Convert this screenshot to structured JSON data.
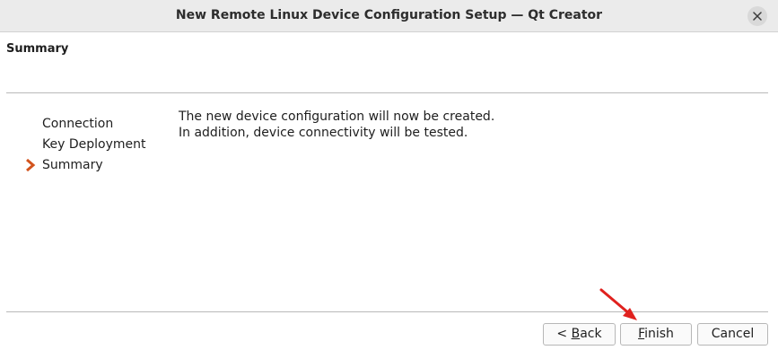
{
  "window": {
    "title": "New Remote Linux Device Configuration Setup — Qt Creator"
  },
  "page": {
    "title": "Summary"
  },
  "steps": [
    {
      "label": "Connection",
      "current": false
    },
    {
      "label": "Key Deployment",
      "current": false
    },
    {
      "label": "Summary",
      "current": true
    }
  ],
  "description": {
    "line1": "The new device configuration will now be created.",
    "line2": "In addition, device connectivity will be tested."
  },
  "buttons": {
    "back": {
      "prefix": "< ",
      "mnemonic": "B",
      "rest": "ack"
    },
    "finish": {
      "mnemonic": "F",
      "rest": "inish"
    },
    "cancel": {
      "label": "Cancel"
    }
  },
  "icons": {
    "close": "close-icon",
    "current_step": "chevron-right-icon",
    "pointer": "red-arrow-annotation"
  },
  "colors": {
    "titlebar": "#ebebeb",
    "step_arrow": "#d2541e",
    "annotation_arrow": "#e0211e"
  }
}
